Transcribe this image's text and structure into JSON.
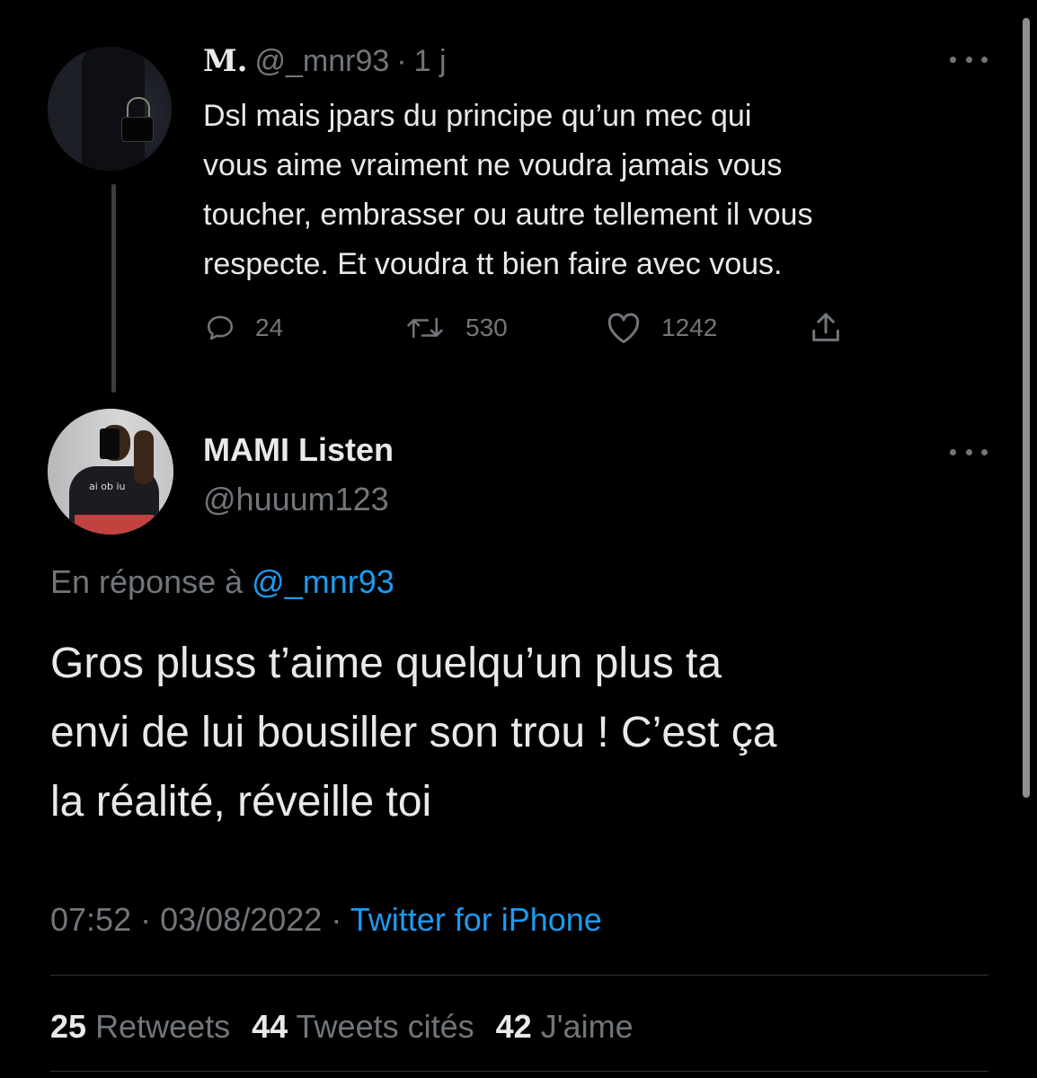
{
  "parent_tweet": {
    "display_name": "M.",
    "handle": "@_mnr93",
    "separator": "·",
    "time": "1 j",
    "body_lines": [
      "Dsl mais jpars du principe qu’un mec qui",
      "vous aime vraiment ne voudra jamais vous",
      "toucher, embrasser ou autre tellement il vous",
      "respecte. Et voudra tt bien faire avec vous."
    ],
    "actions": {
      "replies": "24",
      "retweets": "530",
      "likes": "1242"
    }
  },
  "main_tweet": {
    "display_name": "MAMI Listen",
    "handle": "@huuum123",
    "reply_prefix": "En réponse à",
    "reply_mention": "@_mnr93",
    "body_lines": [
      "Gros pluss t’aime quelqu’un plus ta",
      "envi de lui bousiller son trou ! C’est ça",
      "la réalité, réveille toi"
    ],
    "time": "07:52",
    "date": "03/08/2022",
    "sep": "·",
    "source": "Twitter for iPhone",
    "avatar_shirt_text": "ai ob iu",
    "stats": {
      "retweets_count": "25",
      "retweets_label": "Retweets",
      "quotes_count": "44",
      "quotes_label": "Tweets cités",
      "likes_count": "42",
      "likes_label": "J'aime"
    }
  },
  "colors": {
    "background": "#000000",
    "text": "#e7e9ea",
    "secondary": "#71767b",
    "link": "#1d9bf0",
    "divider": "#2f3336"
  },
  "icons": [
    "reply-icon",
    "retweet-icon",
    "like-icon",
    "share-icon",
    "more-options-icon"
  ]
}
